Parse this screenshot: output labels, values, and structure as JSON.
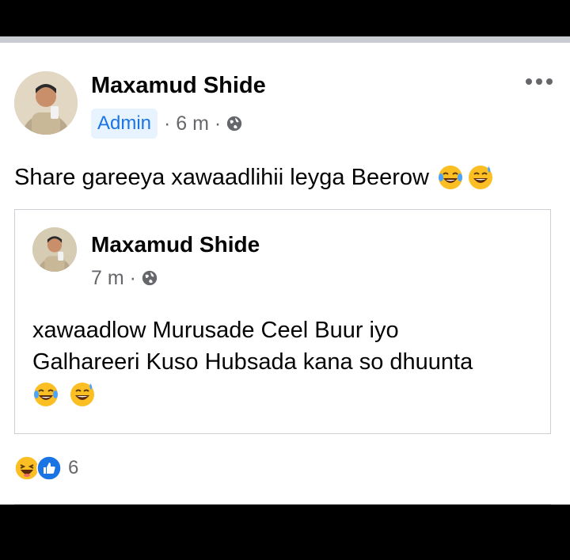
{
  "post": {
    "author": "Maxamud Shide",
    "badge": "Admin",
    "meta": "· 6 m ·",
    "text": "Share gareeya xawaadlihii leyga Beerow",
    "text_emojis": [
      "tears-of-joy-emoji",
      "sweat-smile-emoji"
    ]
  },
  "shared_post": {
    "author": "Maxamud Shide",
    "meta": "7 m ·",
    "text_lines": [
      "xawaadlow Murusade Ceel Buur iyo",
      "Galhareeri Kuso Hubsada kana so dhuunta"
    ],
    "text_emojis": [
      "tears-of-joy-emoji",
      "sweat-smile-emoji"
    ]
  },
  "reactions": {
    "icons": [
      "haha-reaction-icon",
      "like-reaction-icon"
    ],
    "count": "6"
  },
  "colors": {
    "accent": "#1b74e4",
    "badge_bg": "#e7f3ff",
    "meta": "#65676b",
    "emoji": "#fbbf24",
    "tears": "#4aa3ff"
  }
}
